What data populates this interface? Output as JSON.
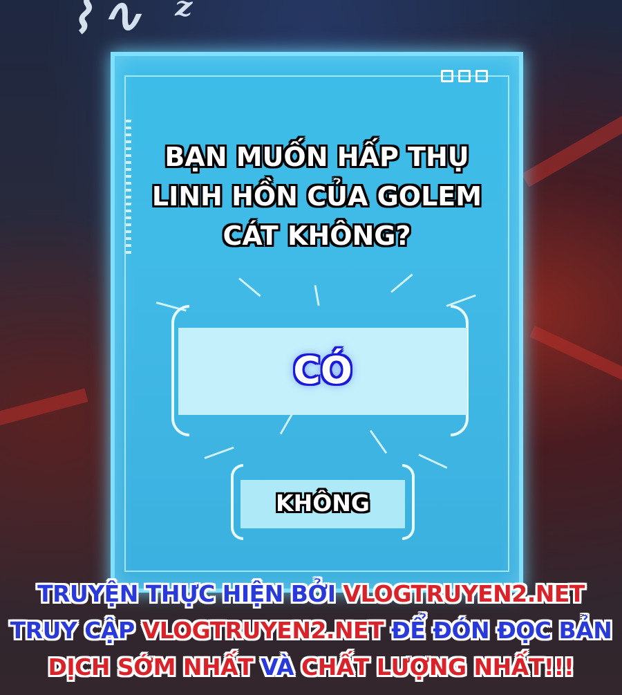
{
  "dialog": {
    "question": "BẠN MUỐN HẤP THỤ\nLINH HỒN CỦA GOLEM\nCÁT KHÔNG?",
    "yes_label": "CÓ",
    "no_label": "KHÔNG",
    "window_controls": [
      "square-icon",
      "square-icon",
      "square-icon"
    ]
  },
  "credits": {
    "line1_a": "TRUYỆN THỰC HIỆN BỞI ",
    "line1_b": "VLOGTRUYEN2.NET",
    "line2_a": "TRUY CẬP ",
    "line2_b": "VLOGTRUYEN2.NET",
    "line2_c": " ĐỂ ĐÓN ĐỌC BẢN",
    "line3_a": "DỊCH SỚM NHẤT ",
    "line3_b": "VÀ",
    "line3_c": " CHẤT LƯỢNG NHẤT!!!"
  },
  "colors": {
    "panel": "#41b9e6",
    "panel_border": "#7fe0ff",
    "yes_text_outline": "#1a1ad8",
    "credit_blue": "#2a3ad8",
    "credit_red": "#d8232a"
  }
}
